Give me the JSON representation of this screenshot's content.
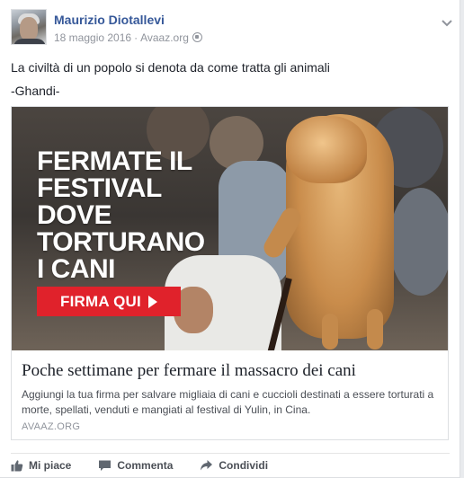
{
  "post": {
    "author": "Maurizio Diotallevi",
    "date": "18 maggio 2016",
    "source": "Avaaz.org",
    "separator": "·",
    "privacy_icon": "globe-icon",
    "menu_icon": "chevron-down-icon",
    "text_line1": "La civiltà di un popolo si denota da come tratta gli animali",
    "text_line2": "-Ghandi-"
  },
  "link_preview": {
    "image_headline": [
      "FERMATE IL",
      "FESTIVAL",
      "DOVE",
      "TORTURANO",
      "I CANI"
    ],
    "cta_label": "FIRMA QUI",
    "title": "Poche settimane per fermare il massacro dei cani",
    "description": "Aggiungi la tua firma per salvare migliaia di cani e cuccioli destinati a essere torturati a morte, spellati, venduti e mangiati al festival di Yulin, in Cina.",
    "domain": "AVAAZ.ORG"
  },
  "actions": {
    "like": "Mi piace",
    "comment": "Commenta",
    "share": "Condividi"
  },
  "colors": {
    "author_link": "#365899",
    "cta_red": "#e0222b",
    "meta_gray": "#90949c"
  }
}
